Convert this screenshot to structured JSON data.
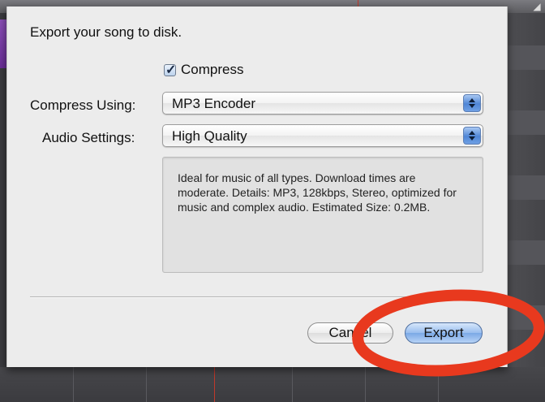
{
  "dialog": {
    "title": "Export your song to disk.",
    "compress_checkbox": {
      "label": "Compress",
      "checked": true,
      "check_glyph": "✓"
    },
    "compress_using": {
      "label": "Compress Using:",
      "value": "MP3 Encoder"
    },
    "audio_settings": {
      "label": "Audio Settings:",
      "value": "High Quality"
    },
    "description": "Ideal for music of all types. Download times are moderate. Details: MP3, 128kbps, Stereo, optimized for music and complex audio. Estimated Size: 0.2MB.",
    "buttons": {
      "cancel": "Cancel",
      "export": "Export"
    }
  },
  "icons": {
    "checkbox": "checkmark-icon",
    "popup_stepper": "up-down-arrows-icon",
    "window_corner": "resize-icon"
  },
  "colors": {
    "annotation_ring": "#e8391e",
    "default_button": "#8fb6ec",
    "playhead": "#c0392b",
    "track_accent": "#7b3fab"
  }
}
